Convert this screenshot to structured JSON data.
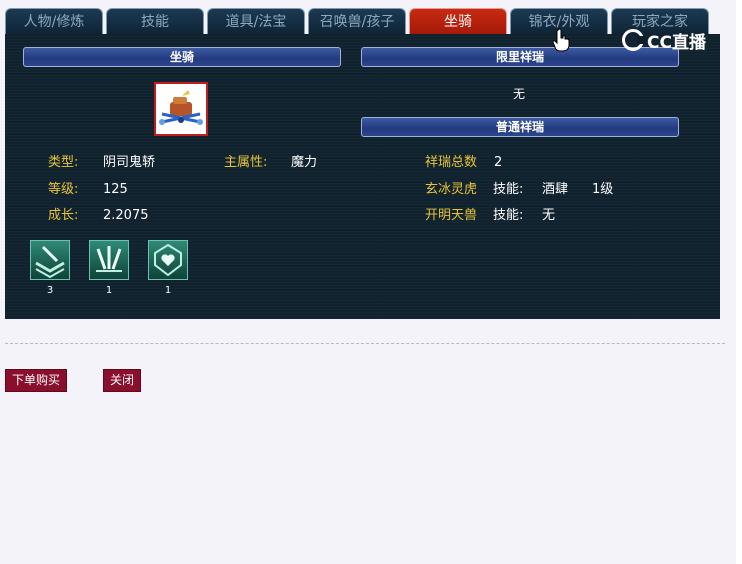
{
  "tabs": [
    {
      "label": "人物/修炼"
    },
    {
      "label": "技能"
    },
    {
      "label": "道具/法宝"
    },
    {
      "label": "召唤兽/孩子"
    },
    {
      "label": "坐骑"
    },
    {
      "label": "锦衣/外观"
    },
    {
      "label": "玩家之家"
    }
  ],
  "active_tab": "坐骑",
  "watermark": "CC直播",
  "mount_section": {
    "header": "坐骑",
    "type_label": "类型:",
    "type_value": "阴司鬼轿",
    "main_attr_label": "主属性:",
    "main_attr_value": "魔力",
    "level_label": "等级:",
    "level_value": "125",
    "growth_label": "成长:",
    "growth_value": "2.2075",
    "skills": [
      {
        "icon": "mount-skill-1-icon",
        "count": "3"
      },
      {
        "icon": "mount-skill-2-icon",
        "count": "1"
      },
      {
        "icon": "mount-skill-3-icon",
        "count": "1"
      }
    ]
  },
  "xiangrui": {
    "limited_header": "限里祥瑞",
    "limited_value": "无",
    "normal_header": "普通祥瑞",
    "total_label": "祥瑞总数",
    "total_value": "2",
    "items": [
      {
        "name": "玄冰灵虎",
        "skill_label": "技能:",
        "skill_value": "酒肆",
        "level": "1级"
      },
      {
        "name": "开明天兽",
        "skill_label": "技能:",
        "skill_value": "无",
        "level": ""
      }
    ]
  },
  "buttons": {
    "order": "下单购买",
    "close": "关闭"
  },
  "colors": {
    "panel_bg": "#11222f",
    "active_tab": "#b8200c",
    "label_gold": "#e8c435",
    "button_red": "#8a0f2c"
  }
}
